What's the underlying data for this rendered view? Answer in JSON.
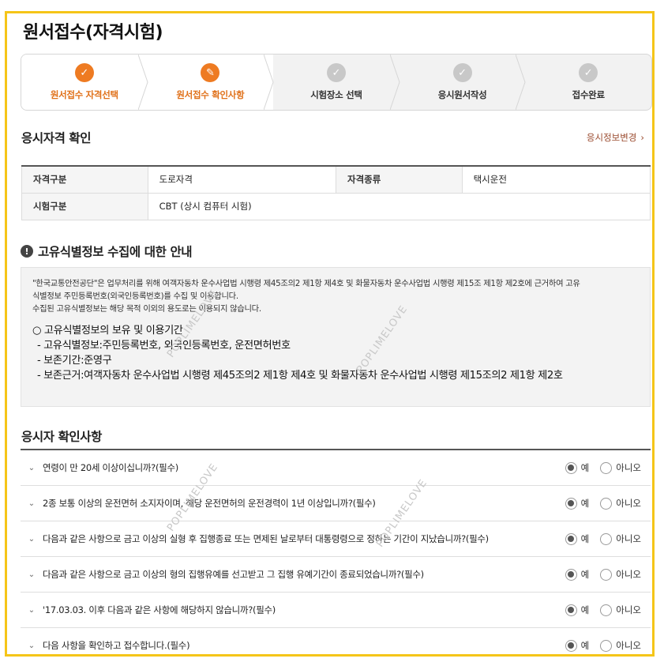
{
  "page_title": "원서접수(자격시험)",
  "steps": [
    {
      "label": "원서접수 자격선택",
      "state": "done",
      "icon": "check-icon"
    },
    {
      "label": "원서접수 확인사항",
      "state": "current",
      "icon": "pencil-icon"
    },
    {
      "label": "시험장소 선택",
      "state": "pending",
      "icon": "check-icon"
    },
    {
      "label": "응시원서작성",
      "state": "pending",
      "icon": "check-icon"
    },
    {
      "label": "접수완료",
      "state": "pending",
      "icon": "check-icon"
    }
  ],
  "qualification": {
    "title": "응시자격 확인",
    "change_link": "응시정보변경",
    "rows": [
      {
        "h1": "자격구분",
        "v1": "도로자격",
        "h2": "자격종류",
        "v2": "택시운전"
      },
      {
        "h1": "시험구분",
        "v1": "CBT (상시 컴퓨터 시험)"
      }
    ]
  },
  "notice": {
    "title": "고유식별정보 수집에 대한 안내",
    "line1": "\"한국교통안전공단\"은 업무처리를 위해 여객자동차 운수사업법 시행령 제45조의2 제1항 제4호 및 화물자동차 운수사업법 시행령 제15조 제1항 제2호에 근거하여 고유",
    "line2": "식별정보 주민등록번호(외국인등록번호)를 수집 및 이용합니다.",
    "line3": "수집된 고유식별정보는 해당 목적 이외의 용도로는 이용되지 않습니다.",
    "big1": "○ 고유식별정보의 보유 및 이용기간",
    "big2": "- 고유식별정보:주민등록번호, 외국인등록번호, 운전면허번호",
    "big3": "- 보존기간:준영구",
    "big4": "- 보존근거:여객자동차 운수사업법 시행령 제45조의2 제1항 제4호 및 화물자동차 운수사업법 시행령 제15조의2 제1항 제2호"
  },
  "confirm": {
    "title": "응시자 확인사항",
    "yes": "예",
    "no": "아니오",
    "items": [
      {
        "q": "연령이 만 20세 이상이십니까?(필수)",
        "selected": "yes"
      },
      {
        "q": "2종 보통 이상의 운전면허 소지자이며, 해당 운전면허의 운전경력이 1년 이상입니까?(필수)",
        "selected": "yes"
      },
      {
        "q": "다음과 같은 사항으로 금고 이상의 실형 후 집행종료 또는 면제된 날로부터 대통령령으로 정하는 기간이 지났습니까?(필수)",
        "selected": "yes"
      },
      {
        "q": "다음과 같은 사항으로 금고 이상의 형의 집행유예를 선고받고 그 집행 유예기간이 종료되었습니까?(필수)",
        "selected": "yes"
      },
      {
        "q": "'17.03.03. 이후 다음과 같은 사항에 해당하지 않습니까?(필수)",
        "selected": "yes"
      },
      {
        "q": "다음 사항을 확인하고 접수합니다.(필수)",
        "selected": "yes"
      }
    ]
  },
  "watermark": "POPLIMELOVE"
}
